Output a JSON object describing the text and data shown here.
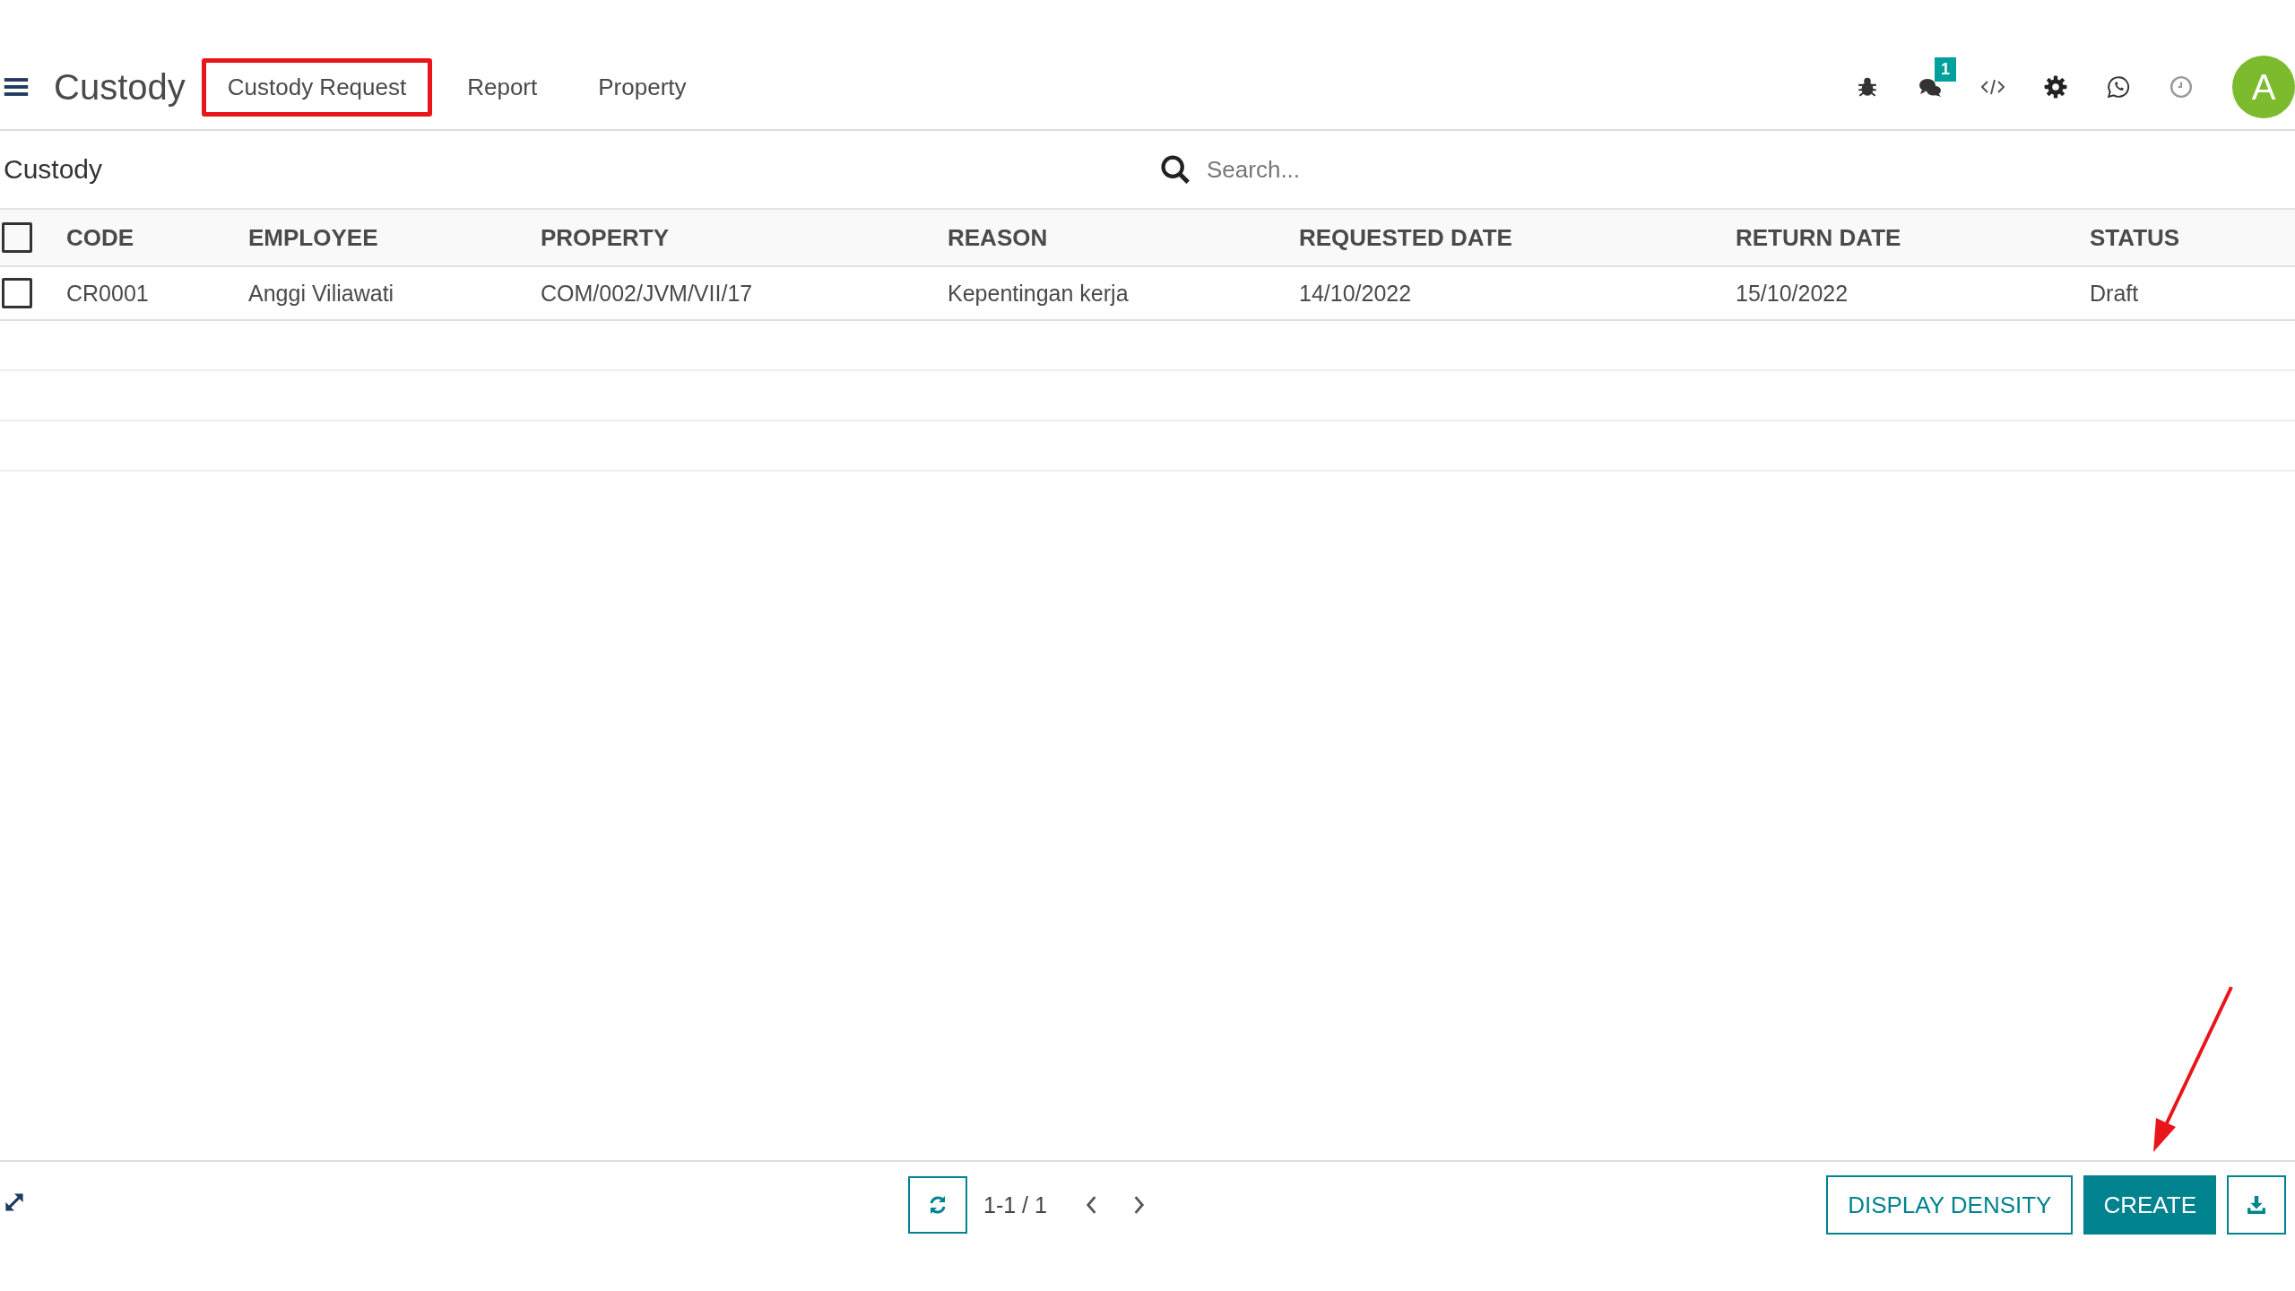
{
  "app": {
    "title": "Custody"
  },
  "menu": [
    {
      "label": "Custody Request",
      "highlighted": true
    },
    {
      "label": "Report",
      "highlighted": false
    },
    {
      "label": "Property",
      "highlighted": false
    }
  ],
  "systray": {
    "message_count": "1",
    "avatar_letter": "A"
  },
  "breadcrumb": "Custody",
  "search": {
    "placeholder": "Search..."
  },
  "table": {
    "select_all_checked": false,
    "columns": [
      "CODE",
      "EMPLOYEE",
      "PROPERTY",
      "REASON",
      "REQUESTED DATE",
      "RETURN DATE",
      "STATUS"
    ],
    "rows": [
      {
        "checked": false,
        "cells": [
          "CR0001",
          "Anggi Viliawati",
          "COM/002/JVM/VII/17",
          "Kepentingan kerja",
          "14/10/2022",
          "15/10/2022",
          "Draft"
        ]
      }
    ]
  },
  "pager": "1-1 / 1",
  "buttons": {
    "display_density": "DISPLAY DENSITY",
    "create": "CREATE",
    "create_pointed_at": true
  }
}
